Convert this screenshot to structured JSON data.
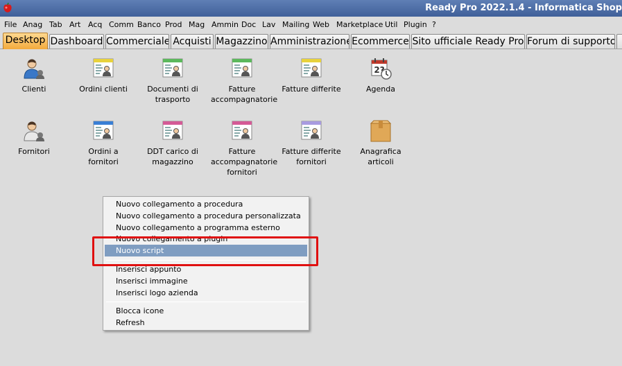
{
  "window": {
    "title": "Ready Pro 2022.1.4 - Informatica Shop"
  },
  "menubar": [
    "File",
    "Anag",
    "Tab",
    "Art",
    "Acq",
    "Comm",
    "Banco",
    "Prod",
    "Mag",
    "Ammin",
    "Doc",
    "Lav",
    "Mailing",
    "Web",
    "Marketplace",
    "Util",
    "Plugin",
    "?"
  ],
  "tabs": [
    "Desktop",
    "Dashboard",
    "Commerciale",
    "Acquisti",
    "Magazzino",
    "Amministrazione",
    "Ecommerce",
    "Sito ufficiale Ready Pro",
    "Forum di supporto"
  ],
  "active_tab": "Desktop",
  "desktop_icons": [
    {
      "label": "Clienti",
      "icon": "customer-icon"
    },
    {
      "label": "Ordini clienti",
      "icon": "doc-yellow-icon"
    },
    {
      "label": "Documenti di trasporto",
      "icon": "doc-green-icon"
    },
    {
      "label": "Fatture accompagnatorie",
      "icon": "doc-green-icon"
    },
    {
      "label": "Fatture differite",
      "icon": "doc-yellow-icon"
    },
    {
      "label": "Agenda",
      "icon": "calendar-icon"
    },
    {
      "label": "Fornitori",
      "icon": "supplier-icon"
    },
    {
      "label": "Ordini a fornitori",
      "icon": "doc-blue-icon"
    },
    {
      "label": "DDT carico di magazzino",
      "icon": "doc-pink-icon"
    },
    {
      "label": "Fatture accompagnatorie fornitori",
      "icon": "doc-pink-icon"
    },
    {
      "label": "Fatture differite fornitori",
      "icon": "doc-lilac-icon"
    },
    {
      "label": "Anagrafica articoli",
      "icon": "box-icon"
    }
  ],
  "context_menu": {
    "items": [
      "Nuovo collegamento a procedura",
      "Nuovo collegamento a procedura personalizzata",
      "Nuovo collegamento a programma esterno",
      "Nuovo collegamento a plugin",
      "Nuovo script",
      "Inserisci appunto",
      "Inserisci immagine",
      "Inserisci logo azienda",
      "Blocca icone",
      "Refresh"
    ],
    "selected": "Nuovo script"
  },
  "colors": {
    "accent": "#f3aa3c",
    "selection": "#7f9dc1",
    "highlight": "#e01010",
    "titlebar": "#4a6aa5"
  }
}
